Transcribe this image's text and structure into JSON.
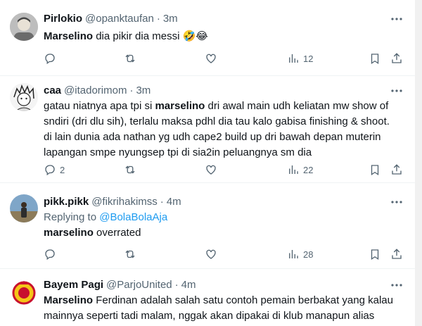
{
  "tweets": [
    {
      "name": "Pirlokio",
      "handle": "@opanktaufan",
      "time": "3m",
      "bold": "Marselino",
      "text": " dia pikir dia messi 🤣😂",
      "reply_count": "",
      "views": "12"
    },
    {
      "name": "caa",
      "handle": "@itadorimom",
      "time": "3m",
      "line1_pre": "gatau niatnya apa tpi si ",
      "line1_bold": "marselino",
      "line1_post": " dri awal main udh keliatan mw show of",
      "line2": "sndiri (dri dlu sih), terlalu maksa pdhl dia tau kalo gabisa finishing & shoot.",
      "line3": "di lain dunia ada nathan yg udh cape2 build up dri bawah depan muterin",
      "line4": "lapangan smpe nyungsep tpi di sia2in peluangnya sm dia",
      "reply_count": "2",
      "views": "22"
    },
    {
      "name": "pikk.pikk",
      "handle": "@fikrihakimss",
      "time": "4m",
      "replying_label": "Replying to ",
      "replying_to": "@BolaBolaAja",
      "bold": "marselino",
      "text": " overrated",
      "reply_count": "",
      "views": "28"
    },
    {
      "name": "Bayem Pagi",
      "handle": "@ParjoUnited",
      "time": "4m",
      "line1_bold": "Marselino",
      "line1_post": " Ferdinan adalah salah satu contoh pemain berbakat yang kalau",
      "line2": "mainnya seperti tadi malam, nggak akan dipakai di klub manapun alias"
    }
  ],
  "dot": "·",
  "colors": {
    "accent": "#1d9bf0",
    "muted": "#536471",
    "text": "#0f1419"
  },
  "icons": [
    "reply-icon",
    "retweet-icon",
    "like-icon",
    "views-icon",
    "bookmark-icon",
    "share-icon",
    "more-icon"
  ]
}
